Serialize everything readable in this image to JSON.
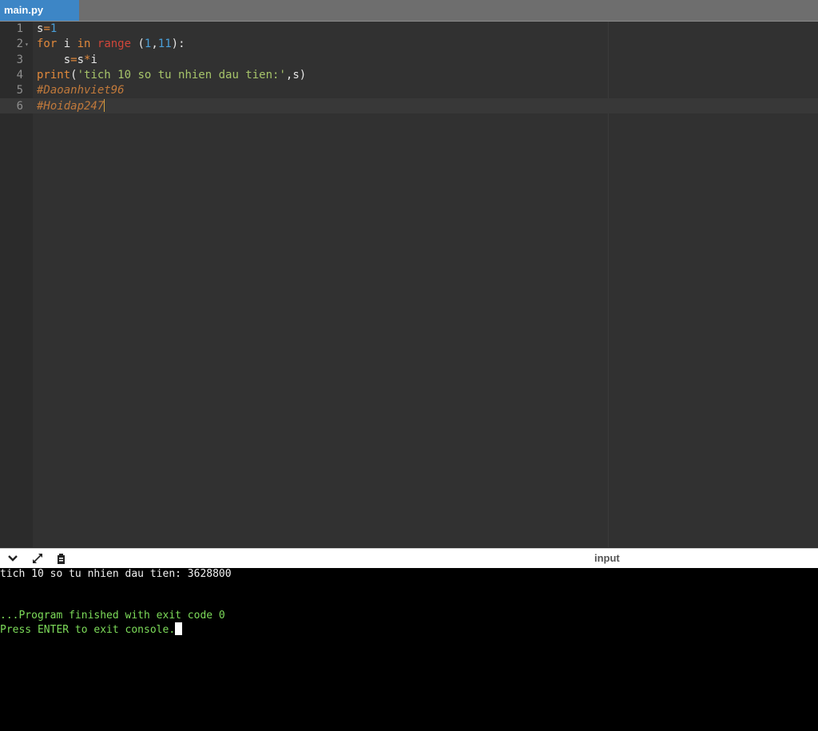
{
  "tab": {
    "label": "main.py"
  },
  "editor": {
    "line_numbers": [
      "1",
      "2",
      "3",
      "4",
      "5",
      "6"
    ],
    "lines": [
      [
        {
          "t": "s",
          "c": ""
        },
        {
          "t": "=",
          "c": "op"
        },
        {
          "t": "1",
          "c": "num"
        }
      ],
      [
        {
          "t": "for",
          "c": "kw"
        },
        {
          "t": " i ",
          "c": ""
        },
        {
          "t": "in",
          "c": "kw"
        },
        {
          "t": " ",
          "c": ""
        },
        {
          "t": "range",
          "c": "bi"
        },
        {
          "t": " (",
          "c": ""
        },
        {
          "t": "1",
          "c": "num"
        },
        {
          "t": ",",
          "c": ""
        },
        {
          "t": "11",
          "c": "num"
        },
        {
          "t": "):",
          "c": ""
        }
      ],
      [
        {
          "t": "    s",
          "c": ""
        },
        {
          "t": "=",
          "c": "op"
        },
        {
          "t": "s",
          "c": ""
        },
        {
          "t": "*",
          "c": "op"
        },
        {
          "t": "i",
          "c": ""
        }
      ],
      [
        {
          "t": "print",
          "c": "fn"
        },
        {
          "t": "(",
          "c": ""
        },
        {
          "t": "'tich 10 so tu nhien dau tien:'",
          "c": "str"
        },
        {
          "t": ",s)",
          "c": ""
        }
      ],
      [
        {
          "t": "#Daoanhviet96",
          "c": "cm"
        }
      ],
      [
        {
          "t": "#Hoidap247",
          "c": "cm"
        }
      ]
    ]
  },
  "console_toolbar": {
    "icons": [
      "chevron-down-icon",
      "expand-icon",
      "clipboard-icon"
    ],
    "input_label": "input"
  },
  "console": {
    "output": "tich 10 so tu nhien dau tien: 3628800",
    "finished": "...Program finished with exit code 0",
    "press_enter": "Press ENTER to exit console."
  },
  "colors": {
    "tab_active": "#3d86c6",
    "editor_bg": "#313131",
    "keyword": "#e0883b",
    "builtin": "#d0463a",
    "number": "#4a9fd8",
    "string": "#a6c46a",
    "comment": "#c0793b",
    "console_ok": "#7ddc5a"
  }
}
